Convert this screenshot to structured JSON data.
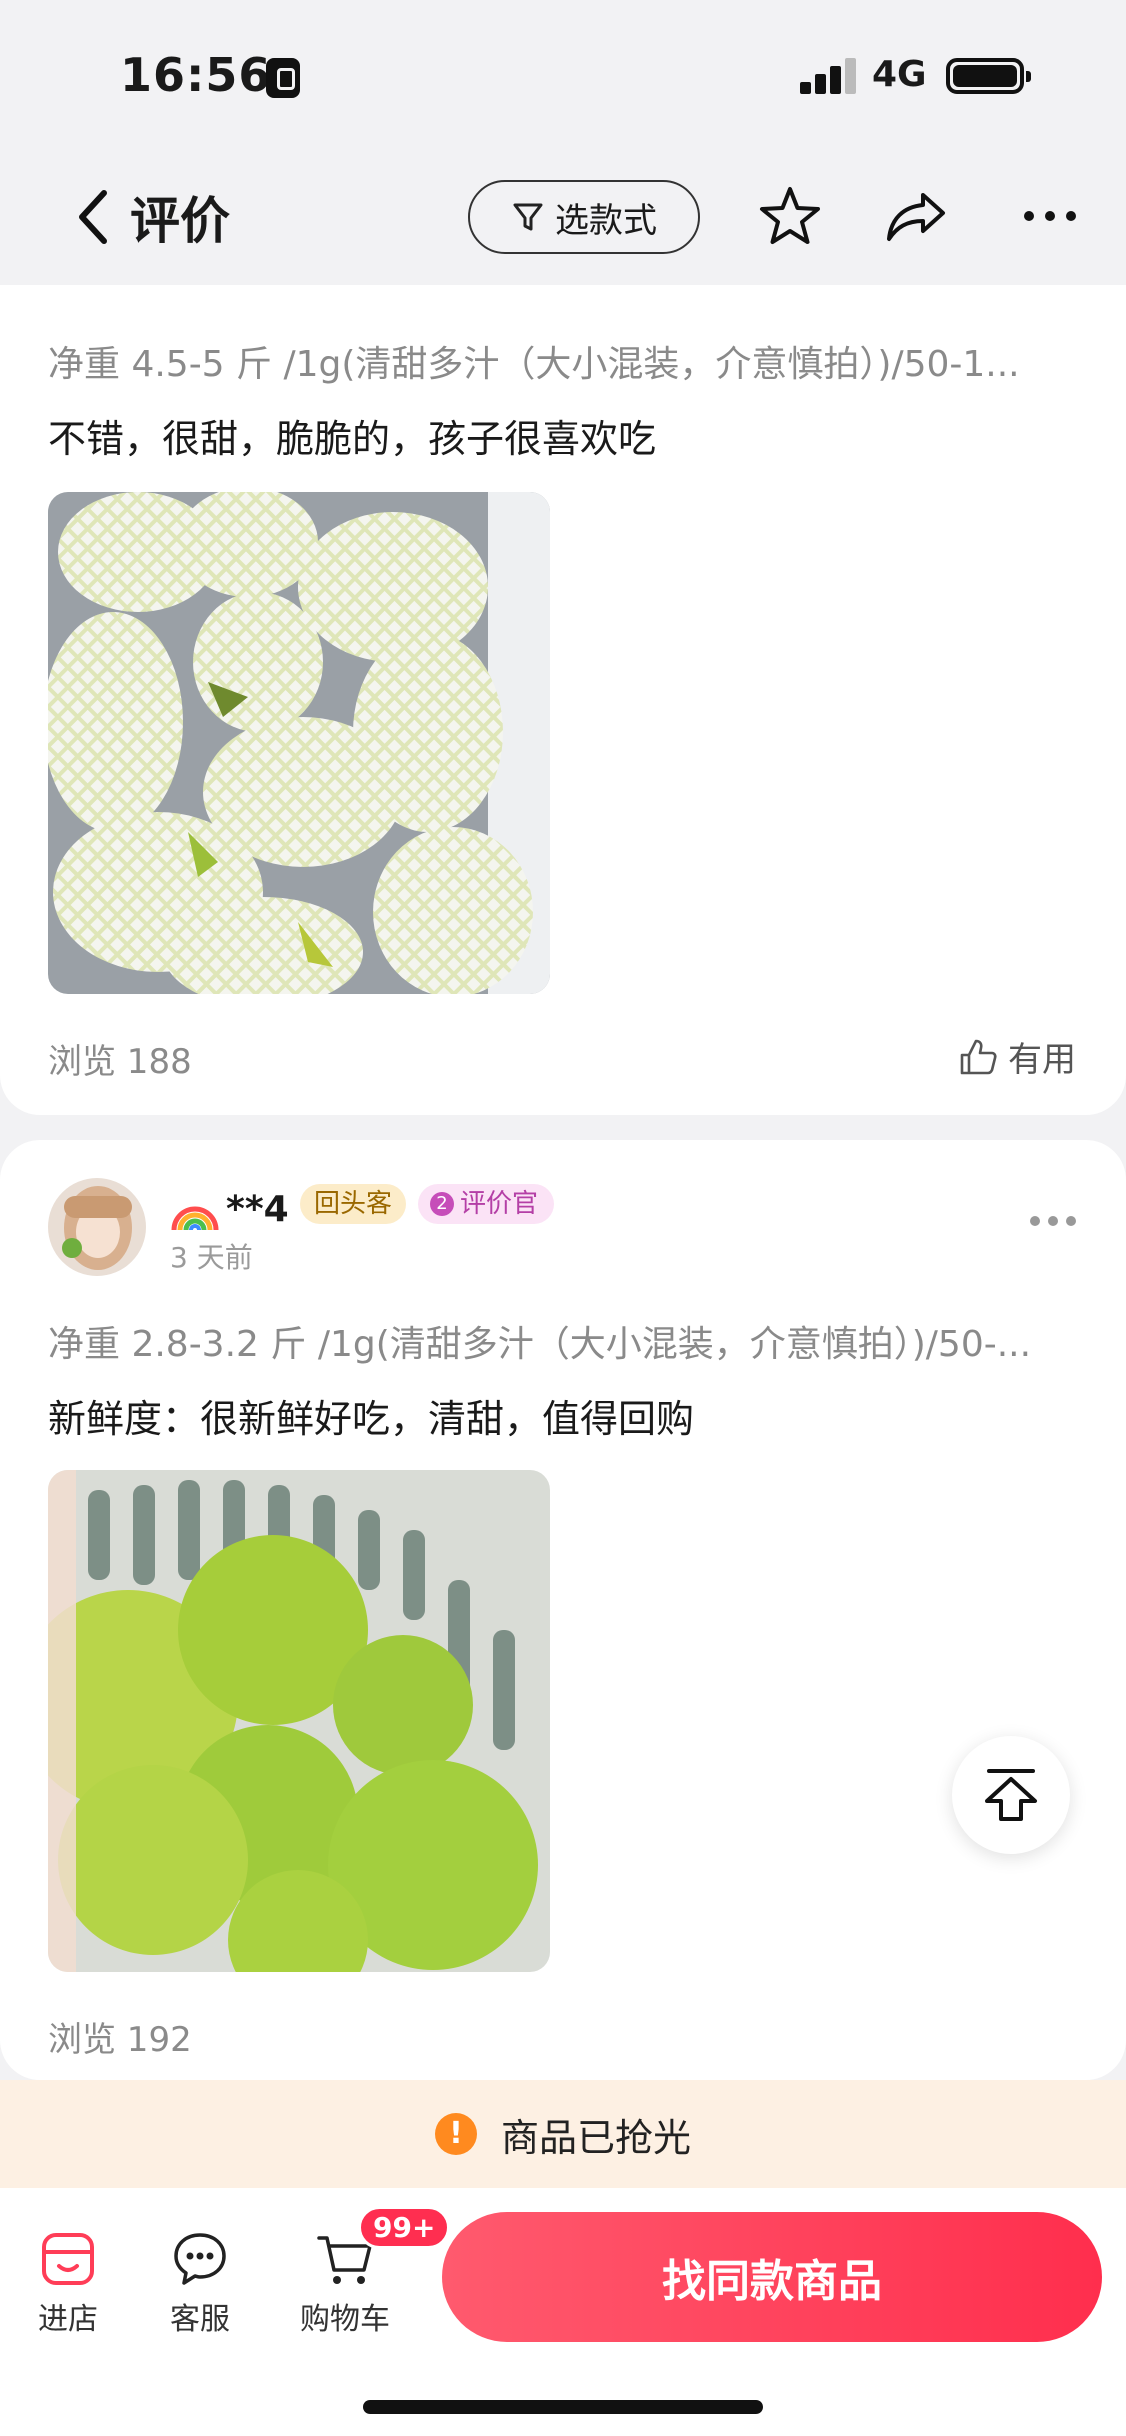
{
  "status_bar": {
    "time": "16:56",
    "network": "4G"
  },
  "nav": {
    "title": "评价",
    "filter_label": "选款式"
  },
  "reviews": [
    {
      "sku": "净重 4.5-5 斤 /1g(清甜多汁（大小混装，介意慎拍）)/50-1...",
      "text": "不错，很甜，脆脆的，孩子很喜欢吃",
      "views": "浏览 188",
      "useful_label": "有用"
    },
    {
      "username": "**4",
      "badge_returning": "回头客",
      "badge_reviewer_level": "2",
      "badge_reviewer": "评价官",
      "time_ago": "3 天前",
      "sku": "净重 2.8-3.2 斤 /1g(清甜多汁（大小混装，介意慎拍）)/50-...",
      "text": "新鲜度：很新鲜好吃，清甜，值得回购",
      "views": "浏览 192"
    }
  ],
  "banner": {
    "text": "商品已抢光",
    "icon": "!"
  },
  "bottom_bar": {
    "store_label": "进店",
    "service_label": "客服",
    "cart_label": "购物车",
    "cart_badge": "99+",
    "find_button": "找同款商品"
  },
  "colors": {
    "accent": "#ff2e4d",
    "banner_bg": "#fdf0e3",
    "warning": "#ff8a1f"
  }
}
